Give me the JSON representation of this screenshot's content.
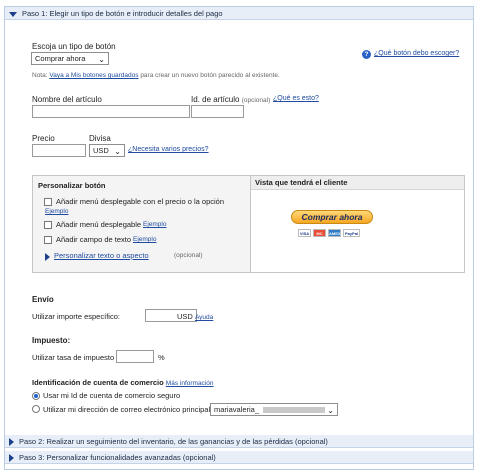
{
  "step1": {
    "title": "Paso 1: Elegir un tipo de botón e introducir detalles del pago"
  },
  "button_type": {
    "label": "Escoja un tipo de botón",
    "selected": "Comprar ahora",
    "help_link": "¿Qué botón debo escoger?"
  },
  "note": {
    "prefix": "Nota:",
    "link": "Vaya a Mis botones guardados",
    "suffix": "para crear un nuevo botón parecido al existente."
  },
  "item": {
    "name_label": "Nombre del artículo",
    "name_value": "",
    "id_label": "Id. de artículo",
    "id_optional": "(opcional)",
    "id_value": "",
    "id_help_link": "¿Qué es esto?"
  },
  "price": {
    "label": "Precio",
    "value": "",
    "currency_label": "Divisa",
    "currency_value": "USD",
    "multi_link": "¿Necesita varios precios?"
  },
  "customize": {
    "title": "Personalizar botón",
    "option1_line1": "Añadir menú desplegable con el precio o la opción",
    "option1_example": "Ejemplo",
    "option2": "Añadir menú desplegable",
    "option2_example": "Ejemplo",
    "option3": "Añadir campo de texto",
    "option3_example": "Ejemplo",
    "text_link": "Personalizar texto o aspecto",
    "text_optional": "(opcional)"
  },
  "preview": {
    "title": "Vista que tendrá el cliente",
    "button_label": "Comprar ahora",
    "cards": [
      "VISA",
      "MC",
      "AMEX",
      "PayPal"
    ]
  },
  "shipping": {
    "title": "Envío",
    "label": "Utilizar importe específico:",
    "value": "",
    "currency": "USD",
    "help_link": "Ayuda"
  },
  "tax": {
    "title": "Impuesto:",
    "label": "Utilizar tasa de impuesto",
    "value": "",
    "unit": "%"
  },
  "merchant": {
    "title": "Identificación de cuenta de comercio",
    "info_link": "Más información",
    "option_secure": "Usar mi Id de cuenta de comercio seguro",
    "option_email": "Utilizar mi dirección de correo electrónico principal",
    "email_value": "mariavaleria_",
    "secure_selected": true
  },
  "step2": {
    "title": "Paso 2: Realizar un seguimiento del inventario, de las ganancias y de las pérdidas (opcional)"
  },
  "step3": {
    "title": "Paso 3: Personalizar funcionalidades avanzadas (opcional)"
  },
  "colors": {
    "accent": "#1f4ba0",
    "header_bg": "#e7eef7",
    "button_gold": "#f6a623"
  }
}
